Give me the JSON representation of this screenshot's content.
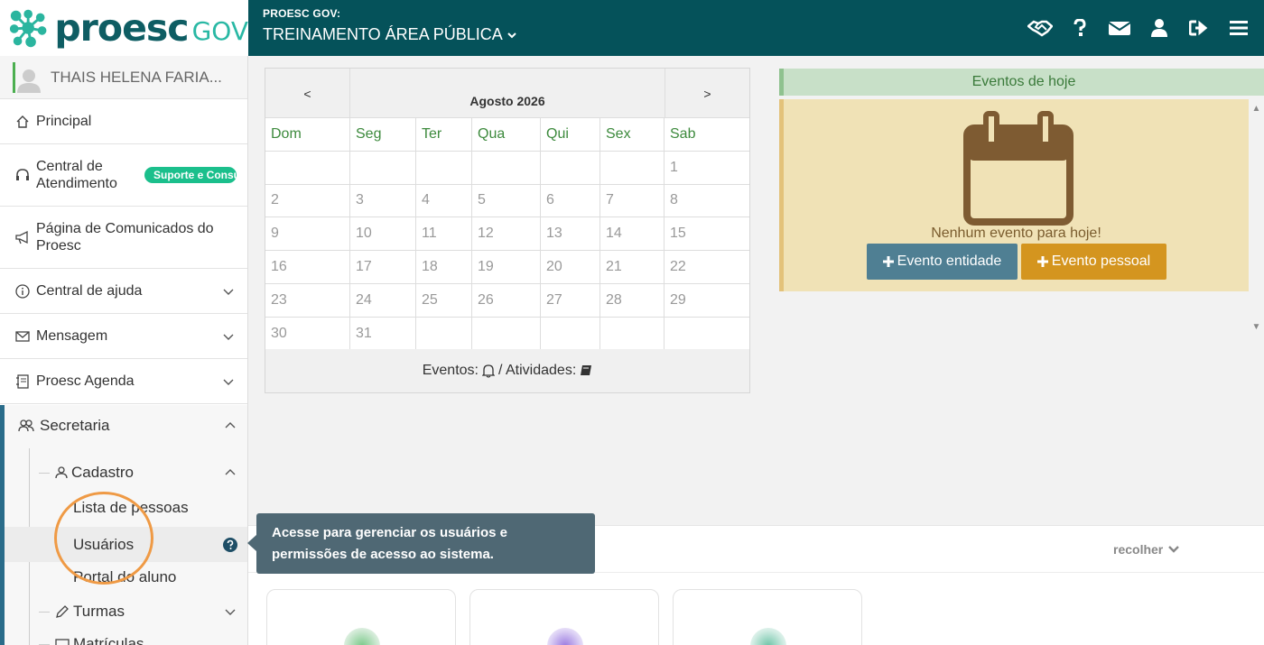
{
  "header": {
    "logo_text": "proesc",
    "logo_suffix": "GOV",
    "org_label": "PROESC GOV:",
    "org_name": "TREINAMENTO ÁREA PÚBLICA",
    "icons": [
      "handshake-icon",
      "help-icon",
      "envelope-icon",
      "user-icon",
      "logout-icon",
      "hamburger-icon"
    ]
  },
  "sidebar": {
    "user_name": "THAIS HELENA FARIA...",
    "items": [
      {
        "label": "Principal",
        "icon": "home-icon"
      },
      {
        "label": "Central de Atendimento",
        "icon": "headset-icon",
        "badge": "Suporte e Consultoria"
      },
      {
        "label": "Página de Comunicados do Proesc",
        "icon": "megaphone-icon"
      },
      {
        "label": "Central de ajuda",
        "icon": "info-icon"
      },
      {
        "label": "Mensagem",
        "icon": "envelope-icon"
      },
      {
        "label": "Proesc Agenda",
        "icon": "agenda-icon"
      }
    ],
    "secretaria": {
      "label": "Secretaria",
      "cadastro": "Cadastro",
      "cadastro_items": [
        "Lista de pessoas",
        "Usuários",
        "Portal do aluno"
      ],
      "turmas": "Turmas",
      "matriculas": "Matrículas"
    }
  },
  "calendar": {
    "prev": "<",
    "next": ">",
    "month": "Agosto 2026",
    "weekdays": [
      "Dom",
      "Seg",
      "Ter",
      "Qua",
      "Qui",
      "Sex",
      "Sab"
    ],
    "weeks": [
      [
        "",
        "",
        "",
        "",
        "",
        "",
        "1"
      ],
      [
        "2",
        "3",
        "4",
        "5",
        "6",
        "7",
        "8"
      ],
      [
        "9",
        "10",
        "11",
        "12",
        "13",
        "14",
        "15"
      ],
      [
        "16",
        "17",
        "18",
        "19",
        "20",
        "21",
        "22"
      ],
      [
        "23",
        "24",
        "25",
        "26",
        "27",
        "28",
        "29"
      ],
      [
        "30",
        "31",
        "",
        "",
        "",
        "",
        ""
      ]
    ],
    "footer_events": "Eventos:",
    "footer_activities": "/ Atividades:"
  },
  "events_today": {
    "title": "Eventos de hoje",
    "empty_message": "Nenhum evento para hoje!",
    "btn_entity": "Evento entidade",
    "btn_personal": "Evento pessoal",
    "colors": {
      "entity": "#4f7f93",
      "personal": "#d4951f"
    }
  },
  "lower": {
    "collapse_label": "recolher"
  },
  "tooltip": {
    "text": "Acesse para gerenciar os usuários e permissões de acesso ao sistema."
  }
}
